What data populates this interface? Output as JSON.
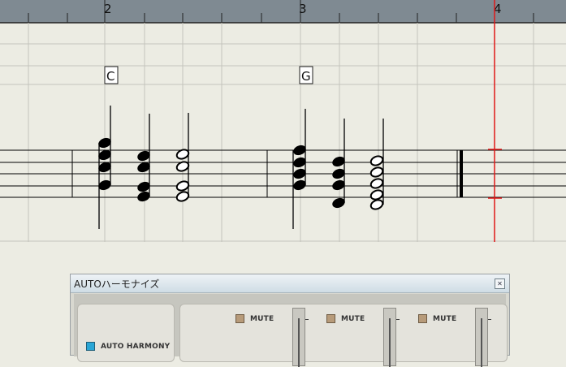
{
  "ruler": {
    "measures": [
      "2",
      "3",
      "4"
    ]
  },
  "chords": [
    {
      "symbol": "C"
    },
    {
      "symbol": "G"
    }
  ],
  "playhead_measure": 4,
  "colors": {
    "playhead": "#e01818",
    "ruler_bg": "#7f8a92",
    "staff": "#000000"
  },
  "panel": {
    "title": "AUTOハーモナイズ",
    "close_icon": "close-icon",
    "auto_harmony_label": "AUTO HARMONY",
    "channels": [
      {
        "mute_label": "MUTE"
      },
      {
        "mute_label": "MUTE"
      },
      {
        "mute_label": "MUTE"
      }
    ]
  }
}
